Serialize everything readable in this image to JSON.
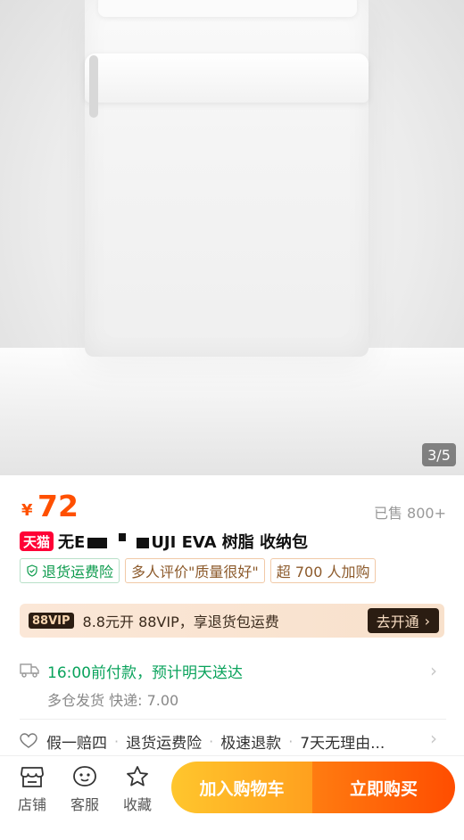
{
  "gallery": {
    "indicator": "3/5"
  },
  "price": {
    "symbol": "¥",
    "value": "72",
    "sold": "已售 800+"
  },
  "title": {
    "badge": "天猫",
    "part1": "无E",
    "part2": "UJI EVA 树脂 收纳包"
  },
  "tags": [
    {
      "label": "退货运费险"
    },
    {
      "label": "多人评价\"质量很好\""
    },
    {
      "label": "超 700 人加购"
    }
  ],
  "vip": {
    "badge": "88VIP",
    "text": "8.8元开 88VIP，享退货包运费",
    "button": "去开通"
  },
  "delivery": {
    "main": "16:00前付款，预计明天送达",
    "sub": "多仓发货  快递: 7.00"
  },
  "service": {
    "items": [
      "假一赔四",
      "退货运费险",
      "极速退款",
      "7天无理由..."
    ]
  },
  "bottom": {
    "shop": "店铺",
    "service": "客服",
    "favorite": "收藏",
    "cart": "加入购物车",
    "buy": "立即购买"
  },
  "colors": {
    "price": "#ff5000",
    "tmall": "#ff0036",
    "delivery": "#0aa35c"
  }
}
